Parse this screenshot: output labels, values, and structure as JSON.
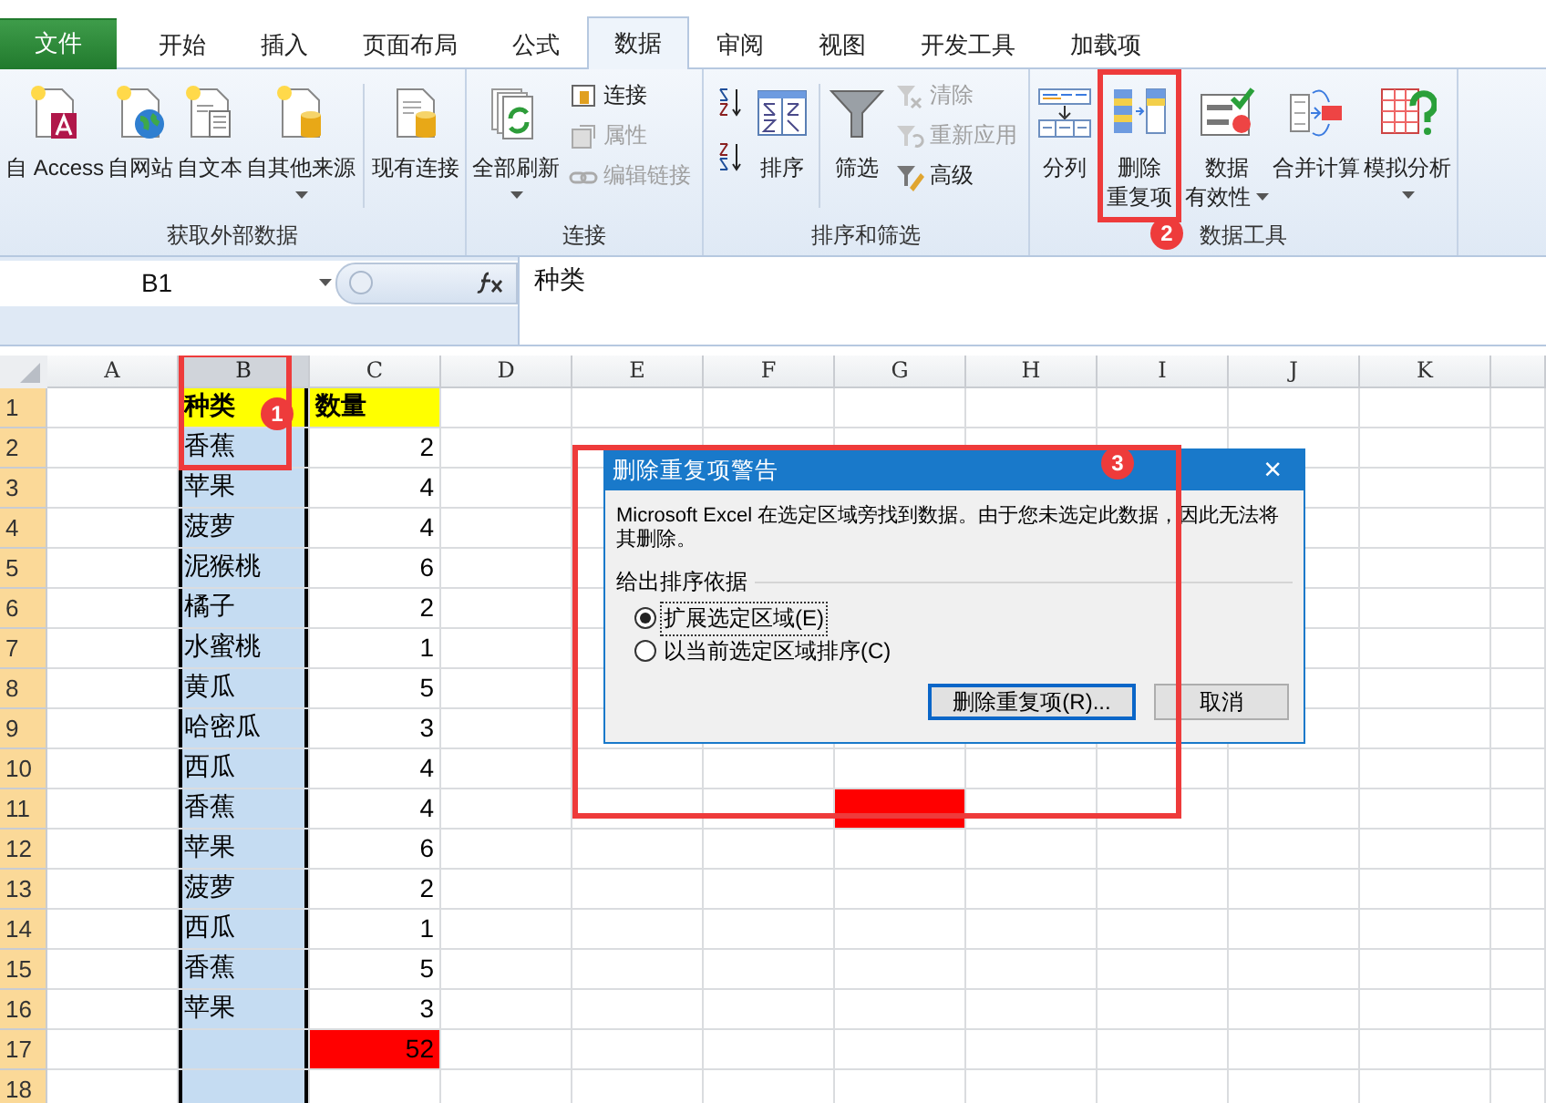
{
  "tabs": [
    {
      "label": "文件",
      "kind": "file",
      "selected": false
    },
    {
      "label": "开始",
      "kind": "tab",
      "selected": false
    },
    {
      "label": "插入",
      "kind": "tab",
      "selected": false
    },
    {
      "label": "页面布局",
      "kind": "tab",
      "selected": false
    },
    {
      "label": "公式",
      "kind": "tab",
      "selected": false
    },
    {
      "label": "数据",
      "kind": "tab",
      "selected": true
    },
    {
      "label": "审阅",
      "kind": "tab",
      "selected": false
    },
    {
      "label": "视图",
      "kind": "tab",
      "selected": false
    },
    {
      "label": "开发工具",
      "kind": "tab",
      "selected": false
    },
    {
      "label": "加载项",
      "kind": "tab",
      "selected": false
    }
  ],
  "ribbon": {
    "groups": [
      {
        "label": "获取外部数据",
        "items": [
          {
            "kind": "large",
            "label_lines": [
              "自 Access"
            ],
            "menu": false
          },
          {
            "kind": "large",
            "label_lines": [
              "自网站"
            ],
            "menu": false
          },
          {
            "kind": "large",
            "label_lines": [
              "自文本"
            ],
            "menu": false
          },
          {
            "kind": "large",
            "label_lines": [
              "自其他来源"
            ],
            "menu": true
          },
          {
            "kind": "separator"
          },
          {
            "kind": "large",
            "label_lines": [
              "现有连接"
            ],
            "menu": false
          }
        ]
      },
      {
        "label": "连接",
        "items": [
          {
            "kind": "large",
            "label_lines": [
              "全部刷新"
            ],
            "menu": true
          },
          {
            "kind": "stack",
            "items": [
              {
                "label": "连接",
                "disabled": false
              },
              {
                "label": "属性",
                "disabled": true
              },
              {
                "label": "编辑链接",
                "disabled": true
              }
            ]
          }
        ]
      },
      {
        "label": "排序和筛选",
        "items": [
          {
            "kind": "icons",
            "items": [
              {
                "kind": "ascending"
              },
              {
                "kind": "descending"
              }
            ]
          },
          {
            "kind": "large",
            "label_lines": [
              "排序"
            ],
            "menu": false
          },
          {
            "kind": "separator"
          },
          {
            "kind": "large",
            "label_lines": [
              "筛选"
            ],
            "menu": false
          },
          {
            "kind": "stack",
            "items": [
              {
                "label": "清除",
                "disabled": true
              },
              {
                "label": "重新应用",
                "disabled": true
              },
              {
                "label": "高级",
                "disabled": false
              }
            ]
          }
        ]
      },
      {
        "label": "数据工具",
        "items": [
          {
            "kind": "large",
            "label_lines": [
              "分列"
            ],
            "menu": false
          },
          {
            "kind": "large",
            "label_lines": [
              "删除",
              "重复项"
            ],
            "menu": false
          },
          {
            "kind": "large",
            "label_lines": [
              "数据",
              "有效性"
            ],
            "menu": true
          },
          {
            "kind": "large",
            "label_lines": [
              "合并计算"
            ],
            "menu": false
          },
          {
            "kind": "large",
            "label_lines": [
              "模拟分析"
            ],
            "menu": true
          }
        ]
      }
    ]
  },
  "formula_bar": {
    "name_box": "B1",
    "formula": "种类"
  },
  "grid": {
    "columns": [
      {
        "label": "A",
        "selected": false
      },
      {
        "label": "B",
        "selected": true
      },
      {
        "label": "C",
        "selected": false
      },
      {
        "label": "D",
        "selected": false
      },
      {
        "label": "E",
        "selected": false
      },
      {
        "label": "F",
        "selected": false
      },
      {
        "label": "G",
        "selected": false
      },
      {
        "label": "H",
        "selected": false
      },
      {
        "label": "I",
        "selected": false
      },
      {
        "label": "J",
        "selected": false
      },
      {
        "label": "K",
        "selected": false
      }
    ],
    "rows": [
      {
        "number": "1",
        "selected": true,
        "cells": [
          {
            "kind": "blank"
          },
          {
            "text": "种类",
            "kind": "header"
          },
          {
            "text": "数量",
            "kind": "header"
          }
        ]
      },
      {
        "number": "2",
        "selected": true,
        "cells": [
          {
            "kind": "blank"
          },
          {
            "text": "香蕉",
            "kind": "selected"
          },
          {
            "text": "2",
            "kind": "number"
          }
        ]
      },
      {
        "number": "3",
        "selected": true,
        "cells": [
          {
            "kind": "blank"
          },
          {
            "text": "苹果",
            "kind": "selected"
          },
          {
            "text": "4",
            "kind": "number"
          }
        ]
      },
      {
        "number": "4",
        "selected": true,
        "cells": [
          {
            "kind": "blank"
          },
          {
            "text": "菠萝",
            "kind": "selected"
          },
          {
            "text": "4",
            "kind": "number"
          }
        ]
      },
      {
        "number": "5",
        "selected": true,
        "cells": [
          {
            "kind": "blank"
          },
          {
            "text": "泥猴桃",
            "kind": "selected"
          },
          {
            "text": "6",
            "kind": "number"
          }
        ]
      },
      {
        "number": "6",
        "selected": true,
        "cells": [
          {
            "kind": "blank"
          },
          {
            "text": "橘子",
            "kind": "selected"
          },
          {
            "text": "2",
            "kind": "number"
          }
        ]
      },
      {
        "number": "7",
        "selected": true,
        "cells": [
          {
            "kind": "blank"
          },
          {
            "text": "水蜜桃",
            "kind": "selected"
          },
          {
            "text": "1",
            "kind": "number"
          }
        ]
      },
      {
        "number": "8",
        "selected": true,
        "cells": [
          {
            "kind": "blank"
          },
          {
            "text": "黄瓜",
            "kind": "selected"
          },
          {
            "text": "5",
            "kind": "number"
          }
        ]
      },
      {
        "number": "9",
        "selected": true,
        "cells": [
          {
            "kind": "blank"
          },
          {
            "text": "哈密瓜",
            "kind": "selected"
          },
          {
            "text": "3",
            "kind": "number"
          }
        ]
      },
      {
        "number": "10",
        "selected": true,
        "cells": [
          {
            "kind": "blank"
          },
          {
            "text": "西瓜",
            "kind": "selected"
          },
          {
            "text": "4",
            "kind": "number"
          }
        ]
      },
      {
        "number": "11",
        "selected": true,
        "cells": [
          {
            "kind": "blank"
          },
          {
            "text": "香蕉",
            "kind": "selected"
          },
          {
            "text": "4",
            "kind": "number"
          },
          {
            "kind": "blank"
          },
          {
            "kind": "blank"
          },
          {
            "kind": "blank"
          },
          {
            "kind": "alert"
          }
        ]
      },
      {
        "number": "12",
        "selected": true,
        "cells": [
          {
            "kind": "blank"
          },
          {
            "text": "苹果",
            "kind": "selected"
          },
          {
            "text": "6",
            "kind": "number"
          }
        ]
      },
      {
        "number": "13",
        "selected": true,
        "cells": [
          {
            "kind": "blank"
          },
          {
            "text": "菠萝",
            "kind": "selected"
          },
          {
            "text": "2",
            "kind": "number"
          }
        ]
      },
      {
        "number": "14",
        "selected": true,
        "cells": [
          {
            "kind": "blank"
          },
          {
            "text": "西瓜",
            "kind": "selected"
          },
          {
            "text": "1",
            "kind": "number"
          }
        ]
      },
      {
        "number": "15",
        "selected": true,
        "cells": [
          {
            "kind": "blank"
          },
          {
            "text": "香蕉",
            "kind": "selected"
          },
          {
            "text": "5",
            "kind": "number"
          }
        ]
      },
      {
        "number": "16",
        "selected": true,
        "cells": [
          {
            "kind": "blank"
          },
          {
            "text": "苹果",
            "kind": "selected"
          },
          {
            "text": "3",
            "kind": "number"
          }
        ]
      },
      {
        "number": "17",
        "selected": true,
        "cells": [
          {
            "kind": "blank"
          },
          {
            "kind": "selected"
          },
          {
            "text": "52",
            "kind": "alert"
          }
        ]
      },
      {
        "number": "18",
        "selected": true,
        "cells": [
          {
            "kind": "blank"
          },
          {
            "kind": "selected"
          }
        ]
      }
    ]
  },
  "dialog": {
    "title": "删除重复项警告",
    "close": "×",
    "message": "Microsoft Excel 在选定区域旁找到数据。由于您未选定此数据，因此无法将其删除。",
    "group_label": "给出排序依据",
    "options": [
      {
        "label": "扩展选定区域(E)",
        "selected": true
      },
      {
        "label": "以当前选定区域排序(C)",
        "selected": false
      }
    ],
    "buttons": [
      {
        "label": "删除重复项(R)...",
        "default": true
      },
      {
        "label": "取消",
        "default": false
      }
    ]
  },
  "callouts": [
    {
      "number": "1"
    },
    {
      "number": "2"
    },
    {
      "number": "3"
    }
  ]
}
